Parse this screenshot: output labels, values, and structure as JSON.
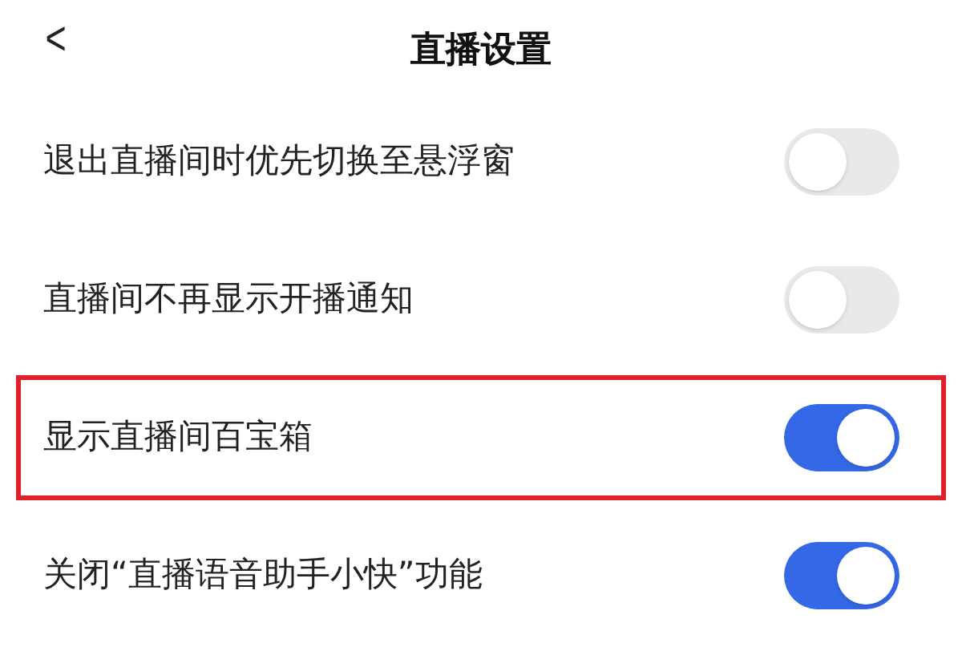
{
  "header": {
    "back": "<",
    "title": "直播设置"
  },
  "settings": [
    {
      "label": "退出直播间时优先切换至悬浮窗",
      "on": false,
      "highlighted": false
    },
    {
      "label": "直播间不再显示开播通知",
      "on": false,
      "highlighted": false
    },
    {
      "label": "显示直播间百宝箱",
      "on": true,
      "highlighted": true
    },
    {
      "label": "关闭“直播语音助手小快”功能",
      "on": true,
      "highlighted": false
    }
  ]
}
